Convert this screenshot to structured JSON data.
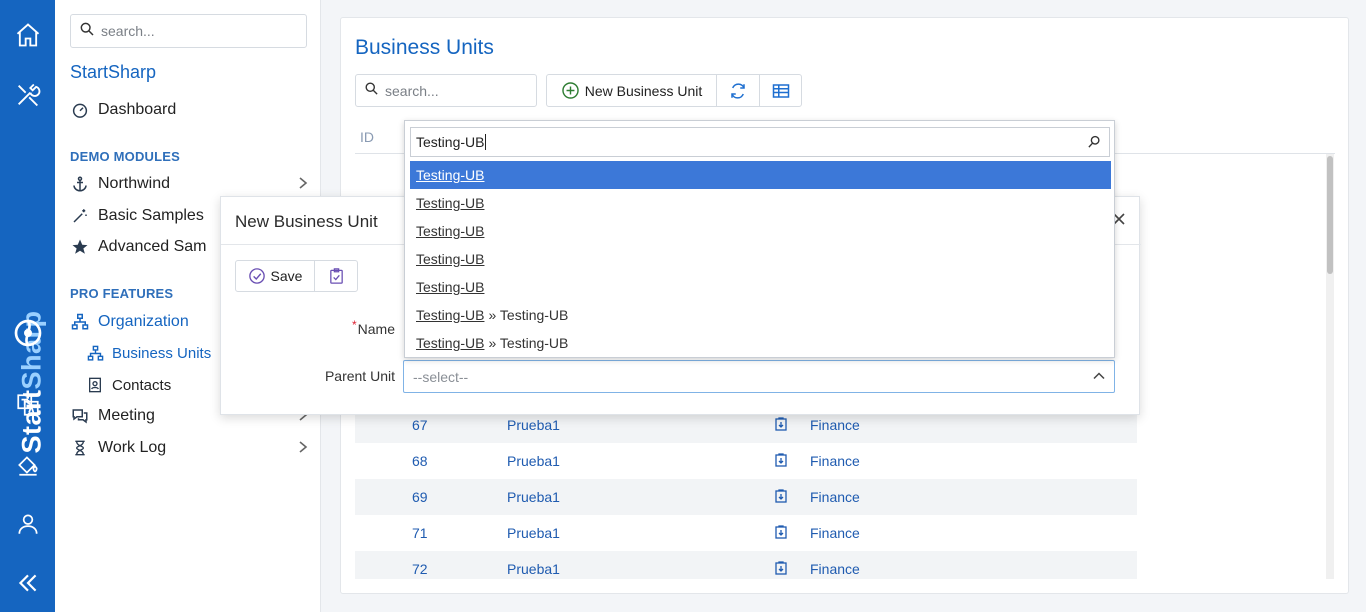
{
  "rail": {
    "brand_start": "Start",
    "brand_sharp": "Sharp"
  },
  "sidebar": {
    "search_placeholder": "search...",
    "brand": "StartSharp",
    "dashboard": "Dashboard",
    "demo_heading": "DEMO MODULES",
    "northwind": "Northwind",
    "basic_samples": "Basic Samples",
    "advanced_samples": "Advanced Sam",
    "pro_heading": "PRO FEATURES",
    "organization": "Organization",
    "business_units": "Business Units",
    "contacts": "Contacts",
    "meeting": "Meeting",
    "work_log": "Work Log"
  },
  "page": {
    "title": "Business Units",
    "search_placeholder": "search...",
    "new_button": "New Business Unit",
    "id_header": "ID",
    "accent": "#1565c0"
  },
  "grid": {
    "rows": [
      {
        "id": "67",
        "name": "Prueba1",
        "dept": "Finance"
      },
      {
        "id": "68",
        "name": "Prueba1",
        "dept": "Finance"
      },
      {
        "id": "69",
        "name": "Prueba1",
        "dept": "Finance"
      },
      {
        "id": "71",
        "name": "Prueba1",
        "dept": "Finance"
      },
      {
        "id": "72",
        "name": "Prueba1",
        "dept": "Finance"
      }
    ]
  },
  "dialog": {
    "title": "New Business Unit",
    "save": "Save",
    "name_label": "Name",
    "required_mark": "*",
    "parent_label": "Parent Unit",
    "parent_placeholder": "--select--"
  },
  "dropdown": {
    "query": "Testing-UB",
    "separator": "»",
    "options": [
      {
        "match": "Testing-UB",
        "tail": ""
      },
      {
        "match": "Testing-UB",
        "tail": ""
      },
      {
        "match": "Testing-UB",
        "tail": ""
      },
      {
        "match": "Testing-UB",
        "tail": ""
      },
      {
        "match": "Testing-UB",
        "tail": ""
      },
      {
        "match": "Testing-UB",
        "tail": "Testing-UB"
      },
      {
        "match": "Testing-UB",
        "tail": "Testing-UB"
      }
    ],
    "selected_color": "#3c78d8"
  }
}
